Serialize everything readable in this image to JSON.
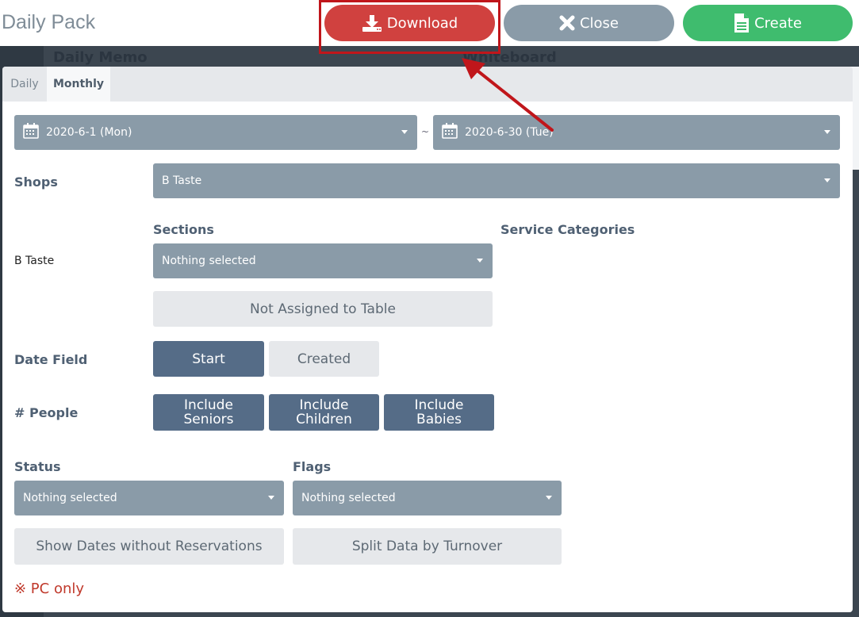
{
  "header": {
    "title": "Daily Pack",
    "download_label": "Download",
    "close_label": "Close",
    "create_label": "Create"
  },
  "background": {
    "daily_memo": "Daily Memo",
    "whiteboard": "Whiteboard"
  },
  "tabs": [
    {
      "label": "Daily",
      "active": false
    },
    {
      "label": "Monthly",
      "active": true
    }
  ],
  "date_range": {
    "start": "2020-6-1 (Mon)",
    "separator": "~",
    "end": "2020-6-30 (Tue)"
  },
  "shops": {
    "label": "Shops",
    "value": "B Taste"
  },
  "sections": {
    "label": "Sections",
    "shop_name": "B Taste",
    "value": "Nothing selected",
    "not_assigned_label": "Not Assigned to Table"
  },
  "service_categories": {
    "label": "Service Categories"
  },
  "date_field": {
    "label": "Date Field",
    "options": [
      "Start",
      "Created"
    ],
    "selected": "Start"
  },
  "people": {
    "label": "# People",
    "options": [
      {
        "line1": "Include",
        "line2": "Seniors"
      },
      {
        "line1": "Include",
        "line2": "Children"
      },
      {
        "line1": "Include",
        "line2": "Babies"
      }
    ]
  },
  "status": {
    "label": "Status",
    "value": "Nothing selected"
  },
  "flags": {
    "label": "Flags",
    "value": "Nothing selected"
  },
  "toggles": {
    "show_dates": "Show Dates without Reservations",
    "split_data": "Split Data by Turnover"
  },
  "note": "※ PC only",
  "colors": {
    "download": "#d0413f",
    "close": "#8a9ba8",
    "create": "#3fbc6e",
    "select": "#8a9ba8",
    "active_button": "#556c87",
    "annotation": "#c0161b"
  }
}
